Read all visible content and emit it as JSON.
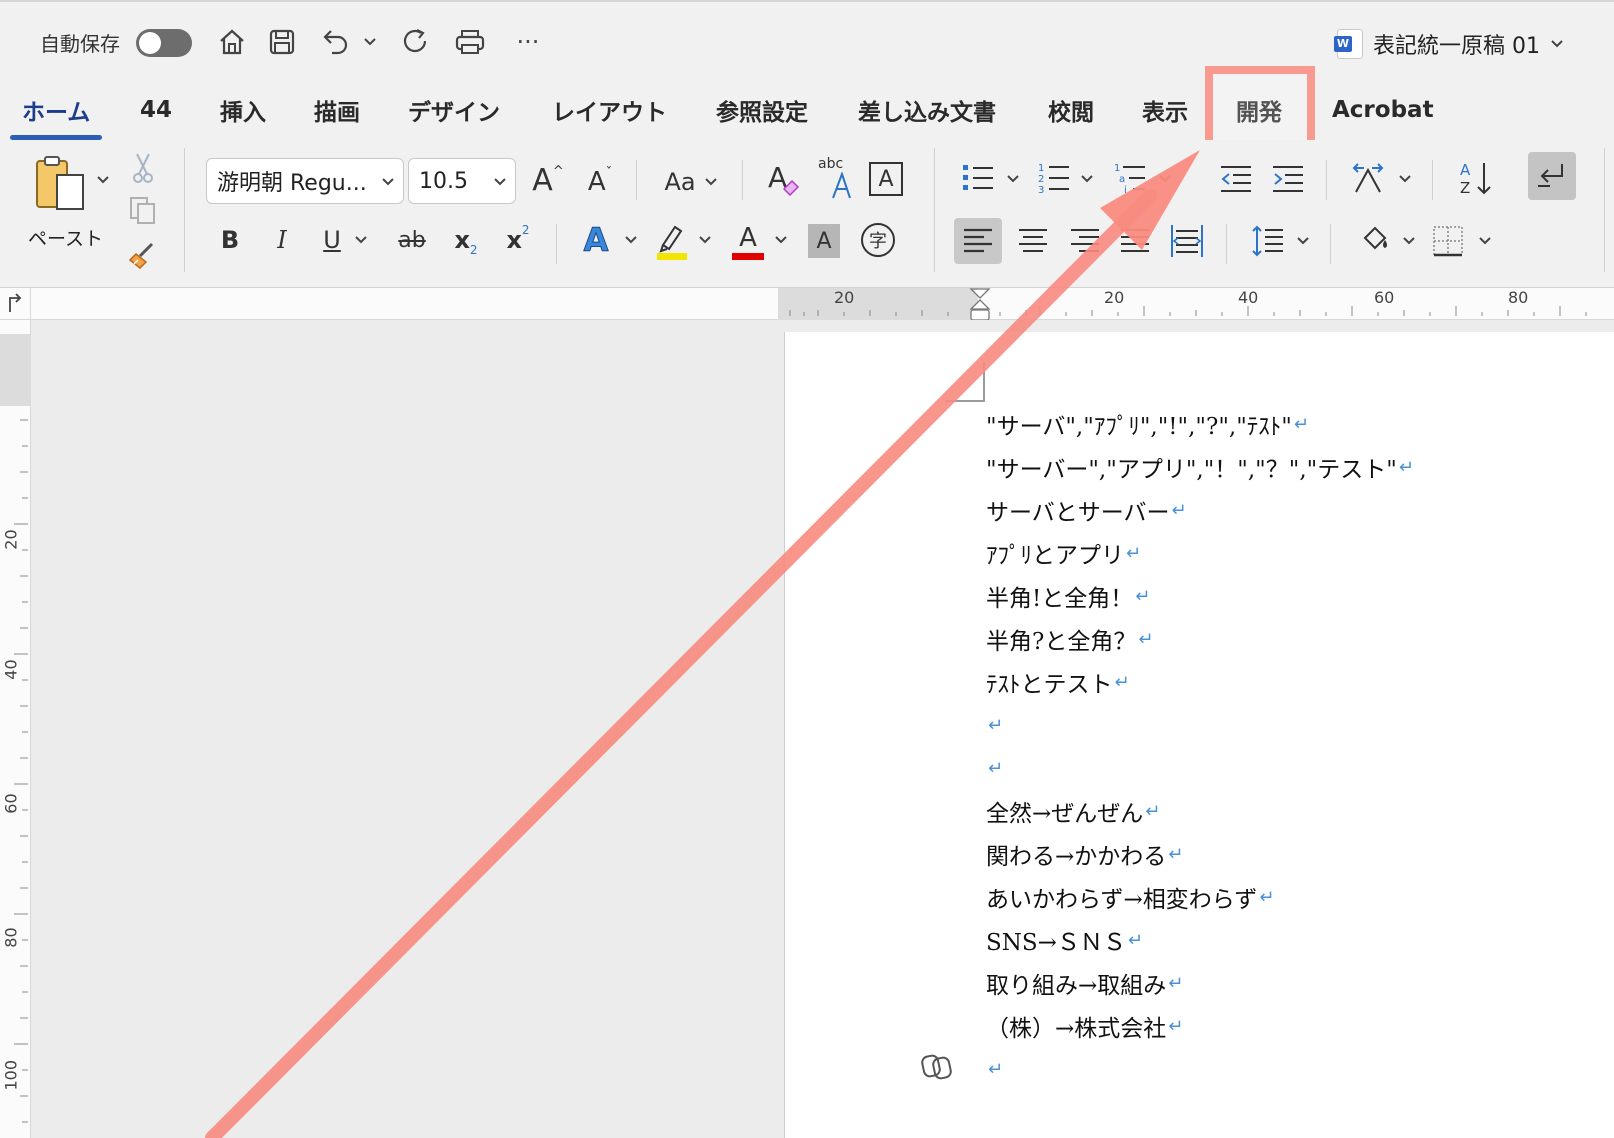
{
  "titlebar": {
    "autosave_label": "自動保存",
    "autosave_state": "off",
    "quick_access": [
      "home-icon",
      "save-icon",
      "undo-icon",
      "redo-icon",
      "print-icon",
      "more-icon"
    ],
    "more_label": "···",
    "doc_title": "表記統一原稿 01"
  },
  "tabs": [
    {
      "label": "ホーム",
      "active": true
    },
    {
      "label": "44"
    },
    {
      "label": "挿入"
    },
    {
      "label": "描画"
    },
    {
      "label": "デザイン"
    },
    {
      "label": "レイアウト"
    },
    {
      "label": "参照設定"
    },
    {
      "label": "差し込み文書"
    },
    {
      "label": "校閲"
    },
    {
      "label": "表示"
    },
    {
      "label": "開発",
      "highlighted": true
    },
    {
      "label": "Acrobat"
    }
  ],
  "ribbon": {
    "paste_label": "ペースト",
    "font_name": "游明朝 Regu...",
    "font_size": "10.5",
    "grow_font": "A",
    "shrink_font": "A",
    "change_case": "Aa",
    "abc_label": "abc",
    "bold": "B",
    "italic": "I",
    "underline": "U",
    "strike": "ab",
    "subscript": "x",
    "superscript": "x",
    "sub_mark": "2",
    "sup_mark": "2",
    "text_effect": "A",
    "font_color": "A",
    "shade_char": "A",
    "enclose_char": "字",
    "border_char": "A",
    "highlight_color": "#f5e400",
    "font_color_value": "#e00000"
  },
  "ruler": {
    "horizontal": [
      "20",
      "20",
      "40",
      "60",
      "80"
    ],
    "vertical": [
      "20",
      "40",
      "60",
      "80",
      "100"
    ]
  },
  "document": {
    "lines": [
      "\"サーバ\",\"ｱﾌﾟﾘ\",\"!\",\"?\",\"ﾃｽﾄ\"",
      "\"サーバー\",\"アプリ\",\"！\",\"？\",\"テスト\"",
      "サーバとサーバー",
      "ｱﾌﾟﾘとアプリ",
      "半角!と全角！",
      "半角?と全角？",
      "ﾃｽﾄとテスト",
      "",
      "",
      "全然→ぜんぜん",
      "関わる→かかわる",
      "あいかわらず→相変わらず",
      "SNS→ＳＮＳ",
      "取り組み→取組み",
      "（株）→株式会社",
      ""
    ],
    "return_mark": "↵"
  },
  "annotation": {
    "color": "#f98b80"
  }
}
